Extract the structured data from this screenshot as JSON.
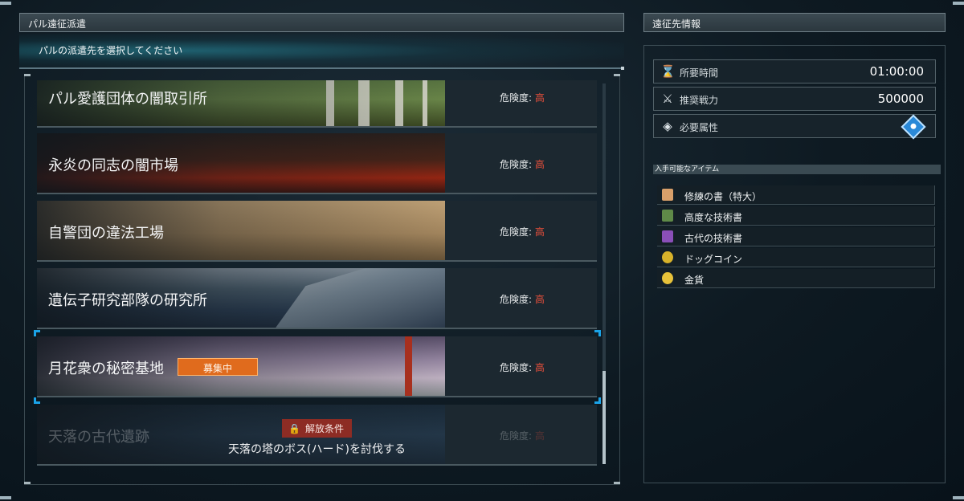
{
  "left_panel": {
    "title": "パル遠征派遣",
    "subtitle": "パルの派遣先を選択してください"
  },
  "destinations": [
    {
      "name": "パル愛護団体の闇取引所",
      "danger_label": "危険度:",
      "danger_level": "高"
    },
    {
      "name": "永炎の同志の闇市場",
      "danger_label": "危険度:",
      "danger_level": "高"
    },
    {
      "name": "自警団の違法工場",
      "danger_label": "危険度:",
      "danger_level": "高"
    },
    {
      "name": "遺伝子研究部隊の研究所",
      "danger_label": "危険度:",
      "danger_level": "高"
    },
    {
      "name": "月花衆の秘密基地",
      "danger_label": "危険度:",
      "danger_level": "高",
      "badge": "募集中",
      "selected": true
    },
    {
      "name": "天落の古代遺跡",
      "danger_label": "危険度:",
      "danger_level": "高",
      "locked": true,
      "lock_label": "解放条件",
      "lock_condition": "天落の塔のボス(ハード)を討伐する"
    }
  ],
  "right_panel": {
    "title": "遠征先情報",
    "stats": [
      {
        "icon": "hourglass-icon",
        "label": "所要時間",
        "value": "01:00:00"
      },
      {
        "icon": "crossed-swords-icon",
        "label": "推奨戦力",
        "value": "500000"
      },
      {
        "icon": "element-diamond-icon",
        "label": "必要属性",
        "value": "water-element-icon"
      }
    ],
    "items_header": "入手可能なアイテム",
    "items": [
      {
        "name": "修練の書（特大）",
        "icon_color": "#d9a06a"
      },
      {
        "name": "高度な技術書",
        "icon_color": "#5f8a48"
      },
      {
        "name": "古代の技術書",
        "icon_color": "#8a4fb8"
      },
      {
        "name": "ドッグコイン",
        "icon_color": "#d8b22a"
      },
      {
        "name": "金貨",
        "icon_color": "#e8c23a"
      }
    ]
  },
  "colors": {
    "danger_high": "#e84f3b",
    "selection": "#1aa3e8",
    "recruit_badge": "#e06b1d",
    "lock_tag": "#8d2c24"
  }
}
